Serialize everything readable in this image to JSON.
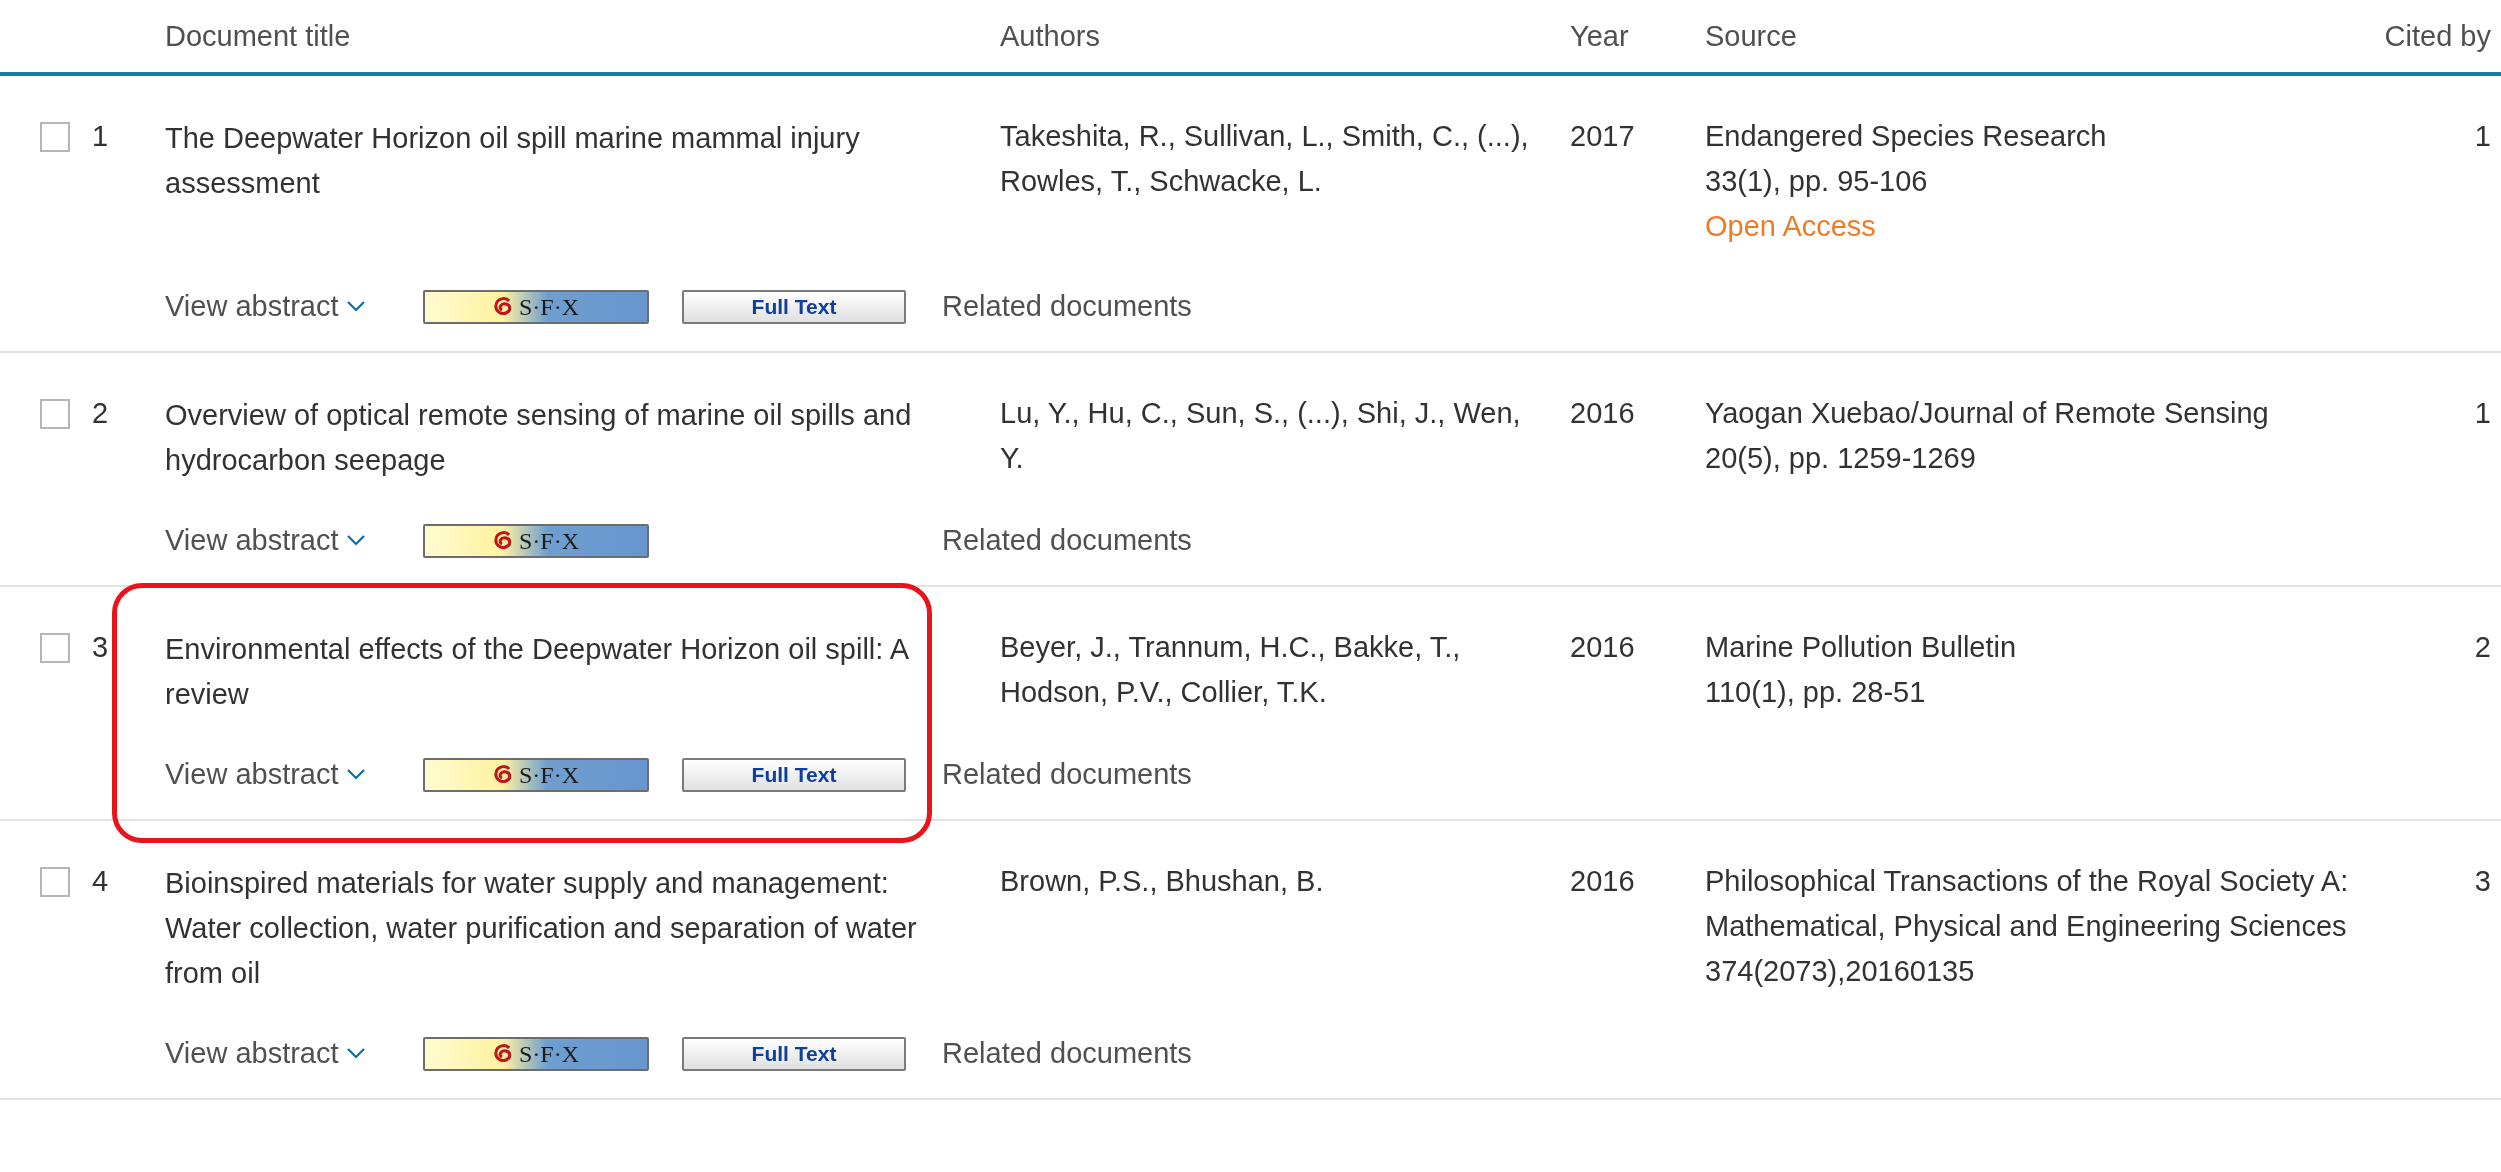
{
  "columns": [
    "Document title",
    "Authors",
    "Year",
    "Source",
    "Cited by"
  ],
  "rows": [
    {
      "number": "1",
      "checked": false,
      "highlighted": false,
      "title": "The Deepwater Horizon oil spill marine mammal injury assessment",
      "authors": "Takeshita, R., Sullivan, L., Smith, C., (...), Rowles, T., Schwacke, L.",
      "year": "2017",
      "source": [
        "Endangered Species Research",
        "33(1), pp. 95-106"
      ],
      "open_access": "Open Access",
      "cited_by": "1",
      "view_abstract": "View abstract",
      "sfx": "S·F·X",
      "full_text": "Full Text",
      "related": "Related documents"
    },
    {
      "number": "2",
      "checked": false,
      "highlighted": false,
      "title": "Overview of optical remote sensing of marine oil spills and hydrocarbon seepage",
      "authors": "Lu, Y., Hu, C., Sun, S., (...), Shi, J., Wen, Y.",
      "year": "2016",
      "source": [
        "Yaogan Xuebao/Journal of Remote Sensing",
        "20(5), pp. 1259-1269"
      ],
      "cited_by": "1",
      "view_abstract": "View abstract",
      "sfx": "S·F·X",
      "related": "Related documents"
    },
    {
      "number": "3",
      "checked": false,
      "highlighted": true,
      "title": "Environmental effects of the Deepwater Horizon oil spill: A review",
      "authors": "Beyer, J., Trannum, H.C., Bakke, T., Hodson, P.V., Collier, T.K.",
      "year": "2016",
      "source": [
        "Marine Pollution Bulletin",
        "110(1), pp. 28-51"
      ],
      "cited_by": "2",
      "view_abstract": "View abstract",
      "sfx": "S·F·X",
      "full_text": "Full Text",
      "related": "Related documents"
    },
    {
      "number": "4",
      "checked": false,
      "highlighted": false,
      "title": "Bioinspired materials for water supply and management: Water collection, water purification and separation of water from oil",
      "authors": "Brown, P.S., Bhushan, B.",
      "year": "2016",
      "source": [
        "Philosophical Transactions of the Royal Society A: Mathematical, Physical and Engineering Sciences",
        "374(2073),20160135"
      ],
      "cited_by": "3",
      "view_abstract": "View abstract",
      "sfx": "S·F·X",
      "full_text": "Full Text",
      "related": "Related documents"
    }
  ]
}
